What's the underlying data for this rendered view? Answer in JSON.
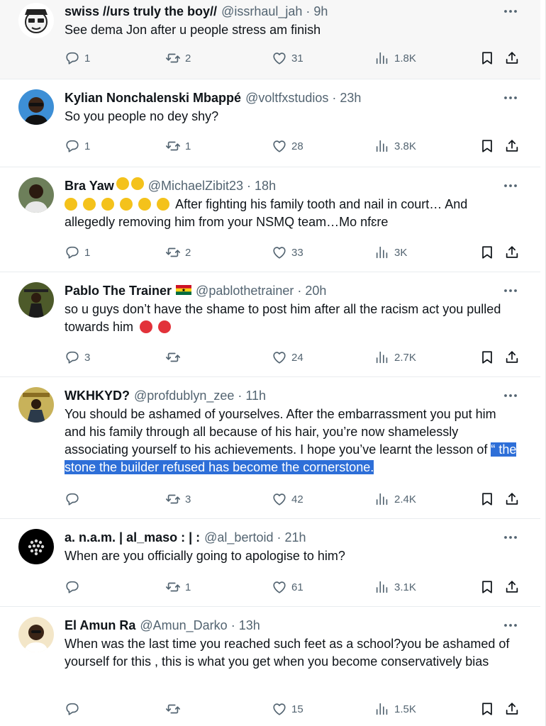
{
  "tweets": [
    {
      "name": "swiss //urs truly the boy//",
      "handle": "@issrhaul_jah",
      "time": "9h",
      "text": "See dema Jon after u people stress am finish",
      "replies": "1",
      "retweets": "2",
      "likes": "31",
      "views": "1.8K"
    },
    {
      "name": "Kylian Nonchalenski Mbappé",
      "handle": "@voltfxstudios",
      "time": "23h",
      "text": "So you people no dey shy?",
      "replies": "1",
      "retweets": "1",
      "likes": "28",
      "views": "3.8K"
    },
    {
      "name": "Bra Yaw",
      "handle": "@MichaelZibit23",
      "time": "18h",
      "text": "After fighting his family tooth and nail in court… And allegedly removing him from your NSMQ team…Mo nfɛre",
      "replies": "1",
      "retweets": "2",
      "likes": "33",
      "views": "3K"
    },
    {
      "name": "Pablo The Trainer",
      "handle": "@pablothetrainer",
      "time": "20h",
      "text": "so u guys don’t have the shame to post him after all the racism act you pulled towards him",
      "replies": "3",
      "retweets": "",
      "likes": "24",
      "views": "2.7K"
    },
    {
      "name": "WKHKYD?",
      "handle": "@profdublyn_zee",
      "time": "11h",
      "text": "You should be ashamed of yourselves. After the embarrassment you put him and his family through all because of his hair, you’re now shamelessly associating yourself to his achievements. I hope you’ve learnt the lesson of",
      "text_selected": "“ the stone the builder refused has become the cornerstone.",
      "replies": "",
      "retweets": "3",
      "likes": "42",
      "views": "2.4K"
    },
    {
      "name": "a. n.a.m. | al_maso : | :",
      "handle": "@al_bertoid",
      "time": "21h",
      "text": "When are you officially going to apologise to him?",
      "replies": "",
      "retweets": "1",
      "likes": "61",
      "views": "3.1K"
    },
    {
      "name": "El Amun Ra",
      "handle": "@Amun_Darko",
      "time": "13h",
      "text": "When was the last time you reached such feet as a school?you be ashamed of yourself for this , this is what you get when you become conservatively bias",
      "replies": "",
      "retweets": "",
      "likes": "15",
      "views": "1.5K"
    }
  ],
  "colors": {
    "text": "#0f1419",
    "muted": "#536471",
    "selection": "#2e6fd8",
    "divider": "#e9ecef"
  },
  "icons": [
    "reply-icon",
    "retweet-icon",
    "like-icon",
    "views-icon",
    "bookmark-icon",
    "share-icon",
    "more-icon"
  ]
}
